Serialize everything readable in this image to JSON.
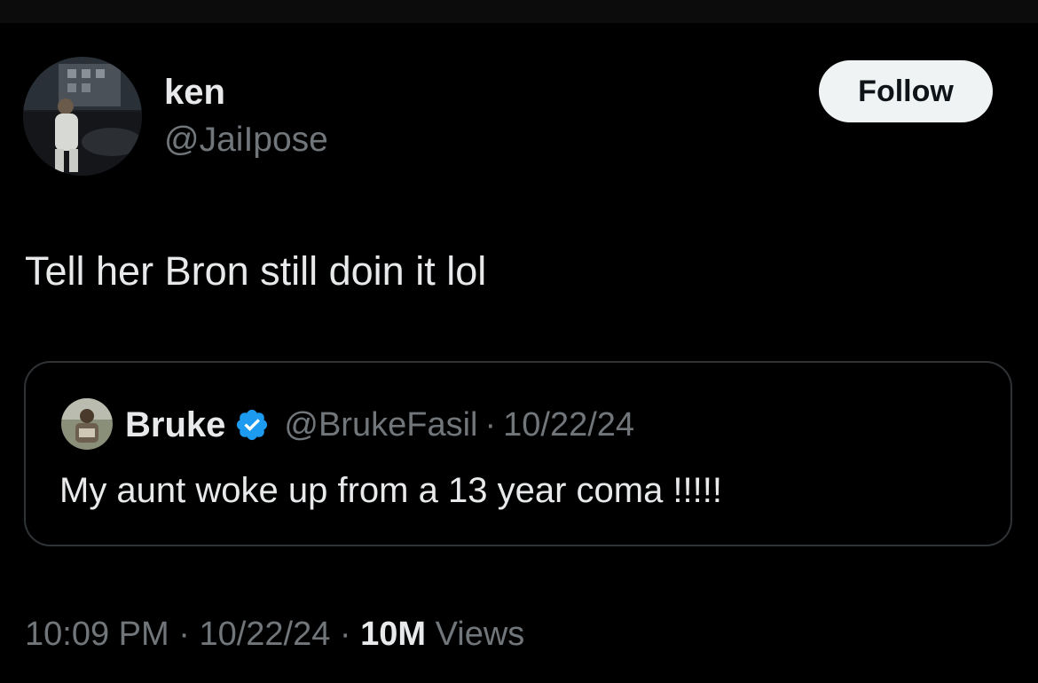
{
  "author": {
    "display_name": "ken",
    "handle": "@JaiIpose"
  },
  "follow_label": "Follow",
  "tweet": {
    "text": "Tell her Bron still doin it lol",
    "time": "10:09 PM",
    "date": "10/22/24",
    "views_count": "10M",
    "views_label": "Views",
    "separator": "·"
  },
  "quote": {
    "display_name": "Bruke",
    "handle": "@BrukeFasil",
    "separator": "·",
    "date": "10/22/24",
    "text": "My aunt woke up from a 13 year coma !!!!!"
  },
  "colors": {
    "background": "#000000",
    "primary_text": "#e7e9ea",
    "secondary_text": "#71767b",
    "verified_badge": "#1d9bf0",
    "follow_button_bg": "#eff3f4",
    "border": "#2f3336"
  }
}
